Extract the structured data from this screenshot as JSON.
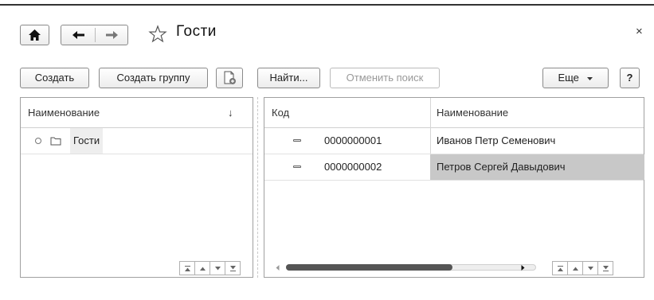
{
  "window": {
    "title": "Гости",
    "close_label": "×"
  },
  "toolbar": {
    "create": "Создать",
    "create_group": "Создать группу",
    "find": "Найти...",
    "cancel_search": "Отменить поиск",
    "more": "Еще",
    "help": "?"
  },
  "tree": {
    "header": "Наименование",
    "sort_indicator": "↓",
    "items": [
      {
        "label": "Гости",
        "icon": "folder-icon"
      }
    ]
  },
  "table": {
    "columns": [
      "Код",
      "Наименование"
    ],
    "rows": [
      {
        "code": "0000000001",
        "name": "Иванов Петр Семенович"
      },
      {
        "code": "0000000002",
        "name": "Петров Сергей Давыдович"
      }
    ],
    "selected_row": 1
  },
  "icons": {
    "home": "home-icon",
    "back": "arrow-left-icon",
    "forward": "arrow-right-icon",
    "favorite": "star-icon",
    "copy": "copy-document-icon",
    "dropdown": "caret-down-icon",
    "scroll": [
      "scroll-top-icon",
      "scroll-up-icon",
      "scroll-down-icon",
      "scroll-bottom-icon"
    ]
  },
  "colors": {
    "selected_row": "#c8c8c8",
    "border": "#a0a0a0"
  }
}
